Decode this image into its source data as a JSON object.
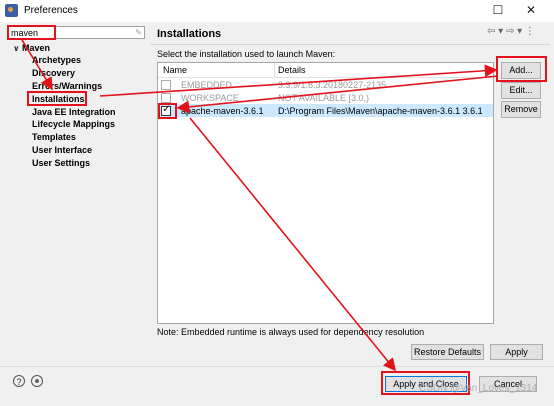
{
  "window": {
    "title": "Preferences",
    "minimize_glyph": "☐",
    "close_glyph": "✕"
  },
  "filter": {
    "value": "maven"
  },
  "tree": {
    "root": "Maven",
    "children": [
      "Archetypes",
      "Discovery",
      "Errors/Warnings",
      "Installations",
      "Java EE Integration",
      "Lifecycle Mappings",
      "Templates",
      "User Interface",
      "User Settings"
    ]
  },
  "pane": {
    "title": "Installations",
    "prompt": "Select the installation used to launch Maven:",
    "columns": [
      "Name",
      "Details"
    ],
    "rows": [
      {
        "name": "EMBEDDED",
        "details": "3.3.9/1.8.3.20180227-2135",
        "checked": false,
        "enabled": false
      },
      {
        "name": "WORKSPACE",
        "details": "NOT AVAILABLE [3.0,)",
        "checked": false,
        "enabled": false
      },
      {
        "name": "apache-maven-3.6.1",
        "details": "D:\\Program Files\\Maven\\apache-maven-3.6.1 3.6.1",
        "checked": true,
        "enabled": true
      }
    ],
    "buttons": {
      "add": "Add...",
      "edit": "Edit...",
      "remove": "Remove"
    },
    "note": "Note: Embedded runtime is always used for dependency resolution",
    "restore_defaults": "Restore Defaults",
    "apply": "Apply",
    "nav_arrows": "⇦ ▾ ⇨ ▾ ⋮"
  },
  "footer": {
    "apply_close": "Apply and Close",
    "cancel": "Cancel",
    "help": "?",
    "watermark": "CSDN @Van_Loves_1314"
  },
  "colors": {
    "highlight": "#e3121b",
    "selection": "#cce8ff"
  }
}
